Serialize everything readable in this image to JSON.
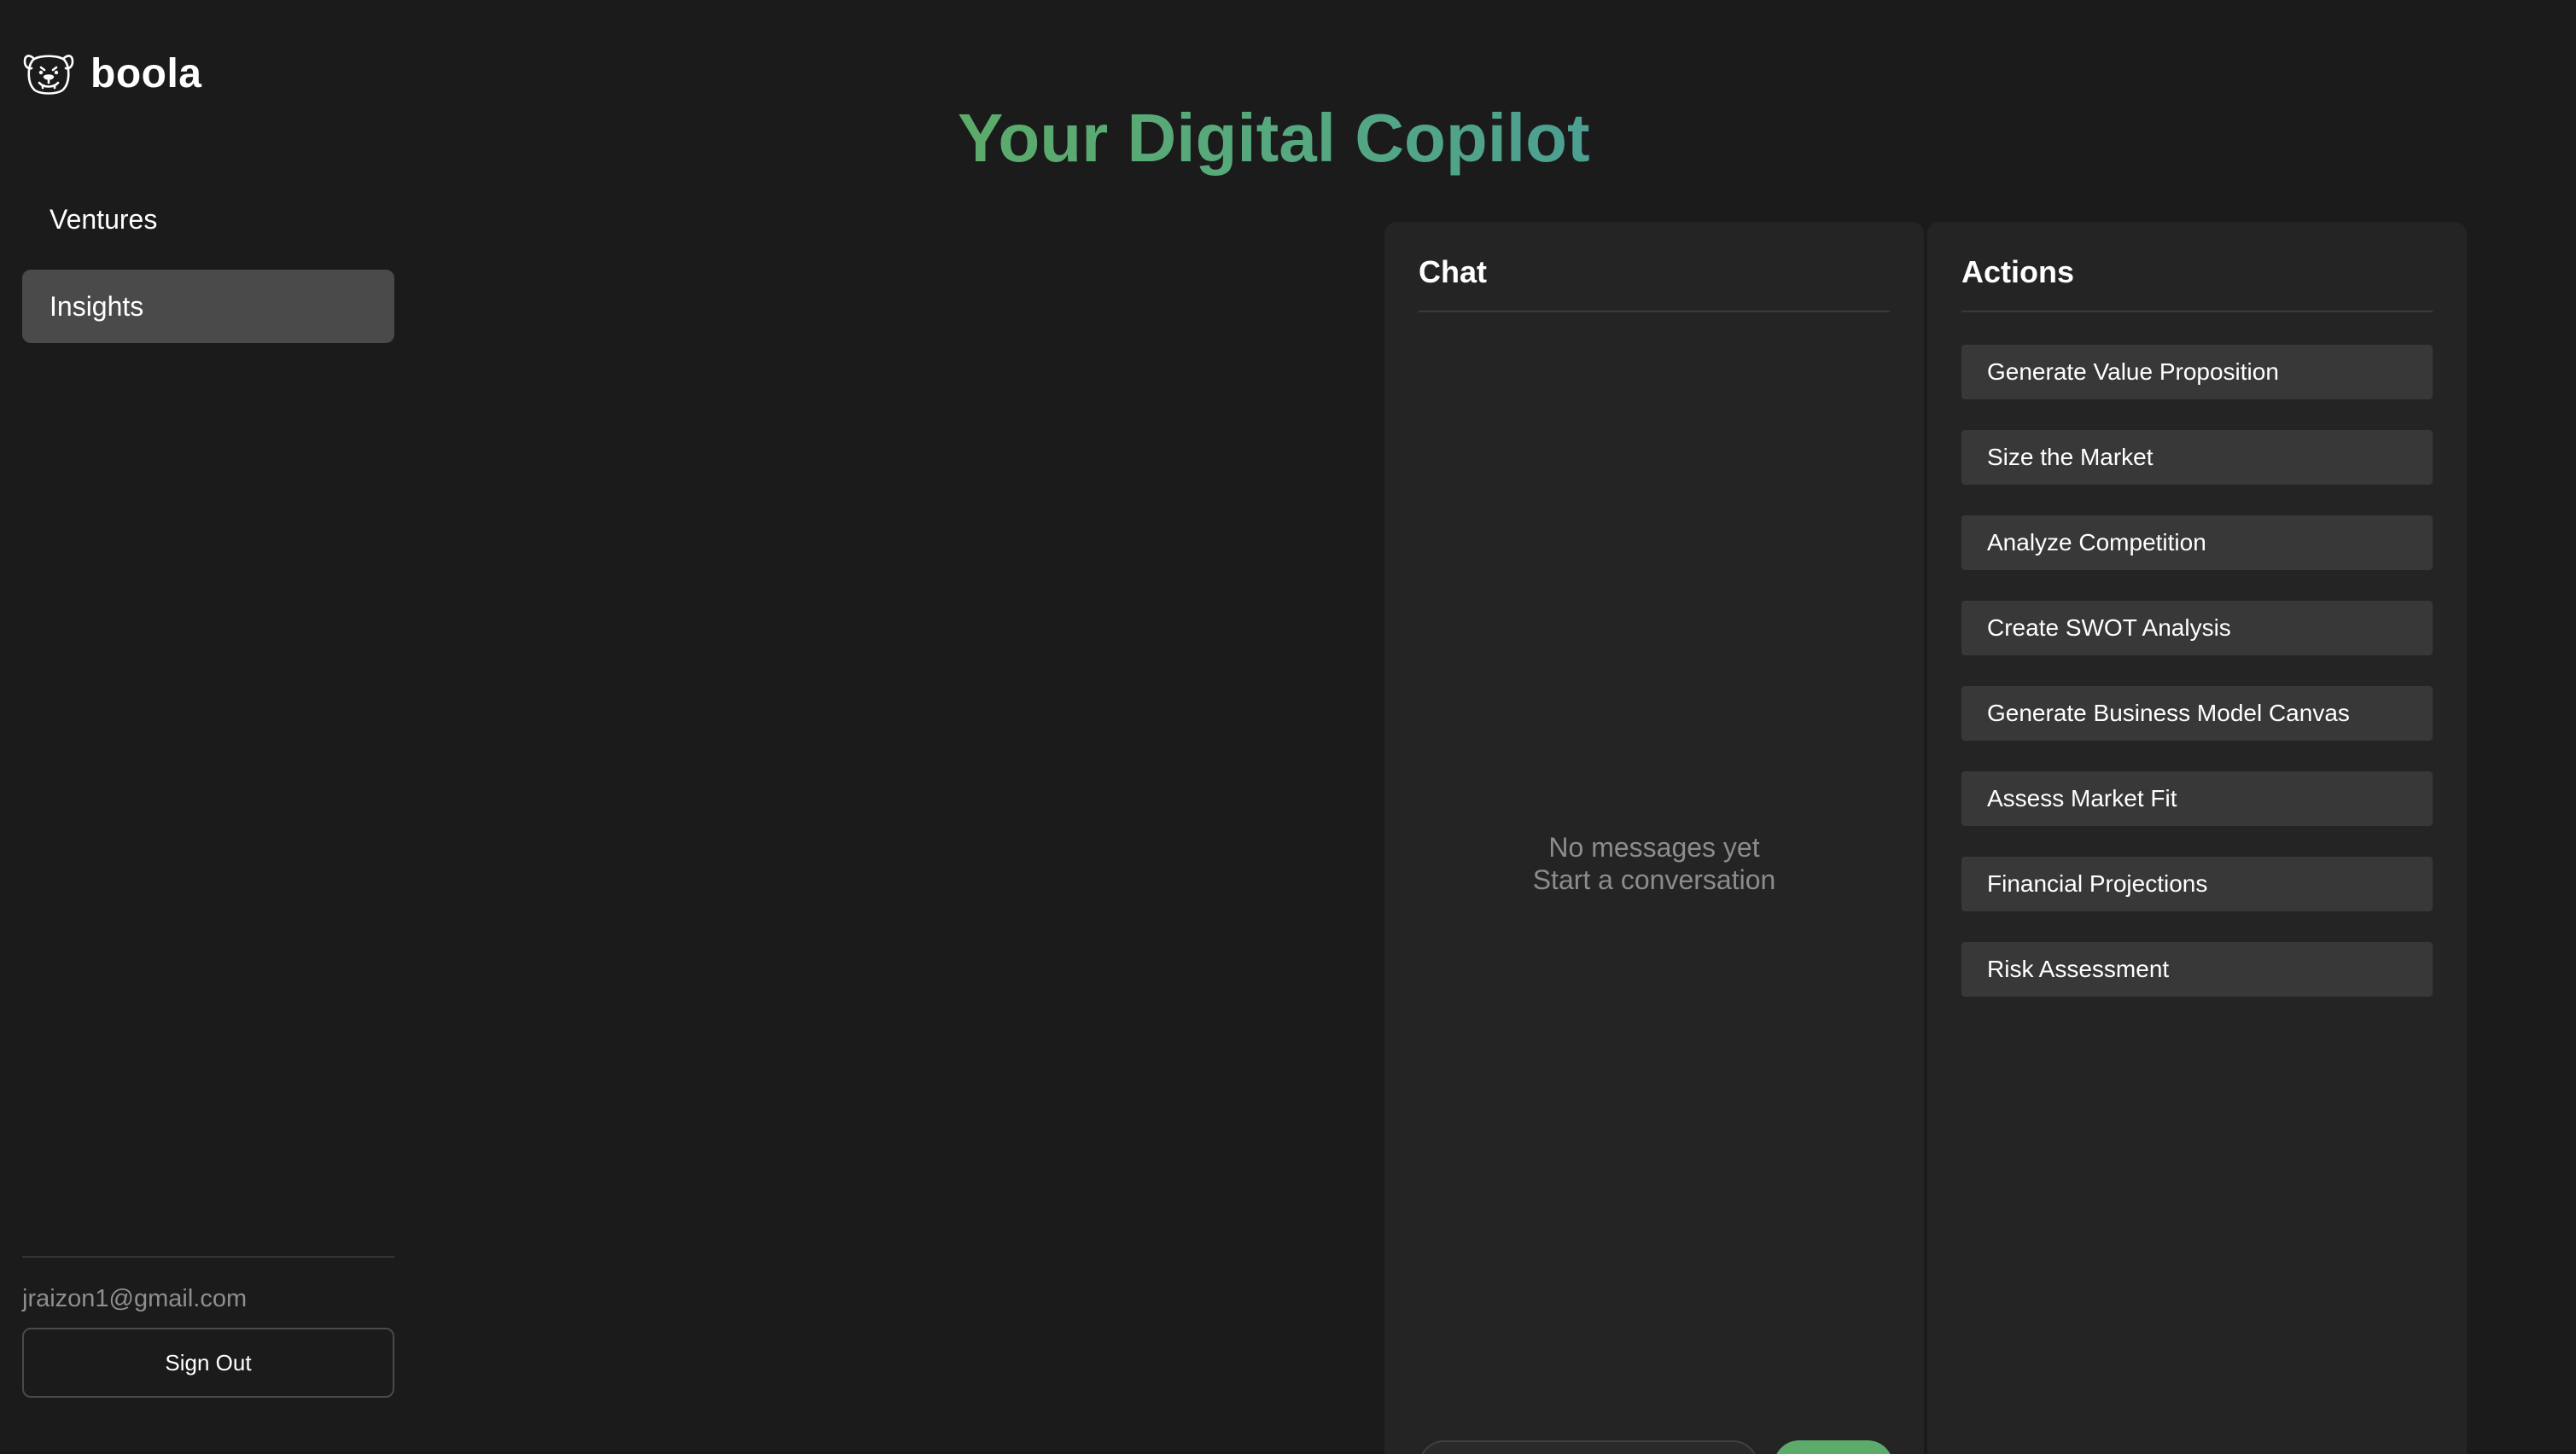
{
  "brand": {
    "name": "boola",
    "icon": "bulldog-icon"
  },
  "sidebar": {
    "items": [
      {
        "label": "Ventures",
        "active": false
      },
      {
        "label": "Insights",
        "active": true
      }
    ],
    "user_email": "jraizon1@gmail.com",
    "sign_out_label": "Sign Out"
  },
  "main": {
    "title": "Your Digital Copilot"
  },
  "chat": {
    "header": "Chat",
    "empty_line1": "No messages yet",
    "empty_line2": "Start a conversation"
  },
  "actions": {
    "header": "Actions",
    "items": [
      {
        "label": "Generate Value Proposition"
      },
      {
        "label": "Size the Market"
      },
      {
        "label": "Analyze Competition"
      },
      {
        "label": "Create SWOT Analysis"
      },
      {
        "label": "Generate Business Model Canvas"
      },
      {
        "label": "Assess Market Fit"
      },
      {
        "label": "Financial Projections"
      },
      {
        "label": "Risk Assessment"
      }
    ]
  },
  "colors": {
    "background": "#1b1b1b",
    "panel": "#242424",
    "active_nav": "#4a4a4a",
    "action_button": "#383838",
    "title_gradient_start": "#5cab6a",
    "title_gradient_end": "#4c9f92",
    "send_button": "#5cab6a"
  }
}
